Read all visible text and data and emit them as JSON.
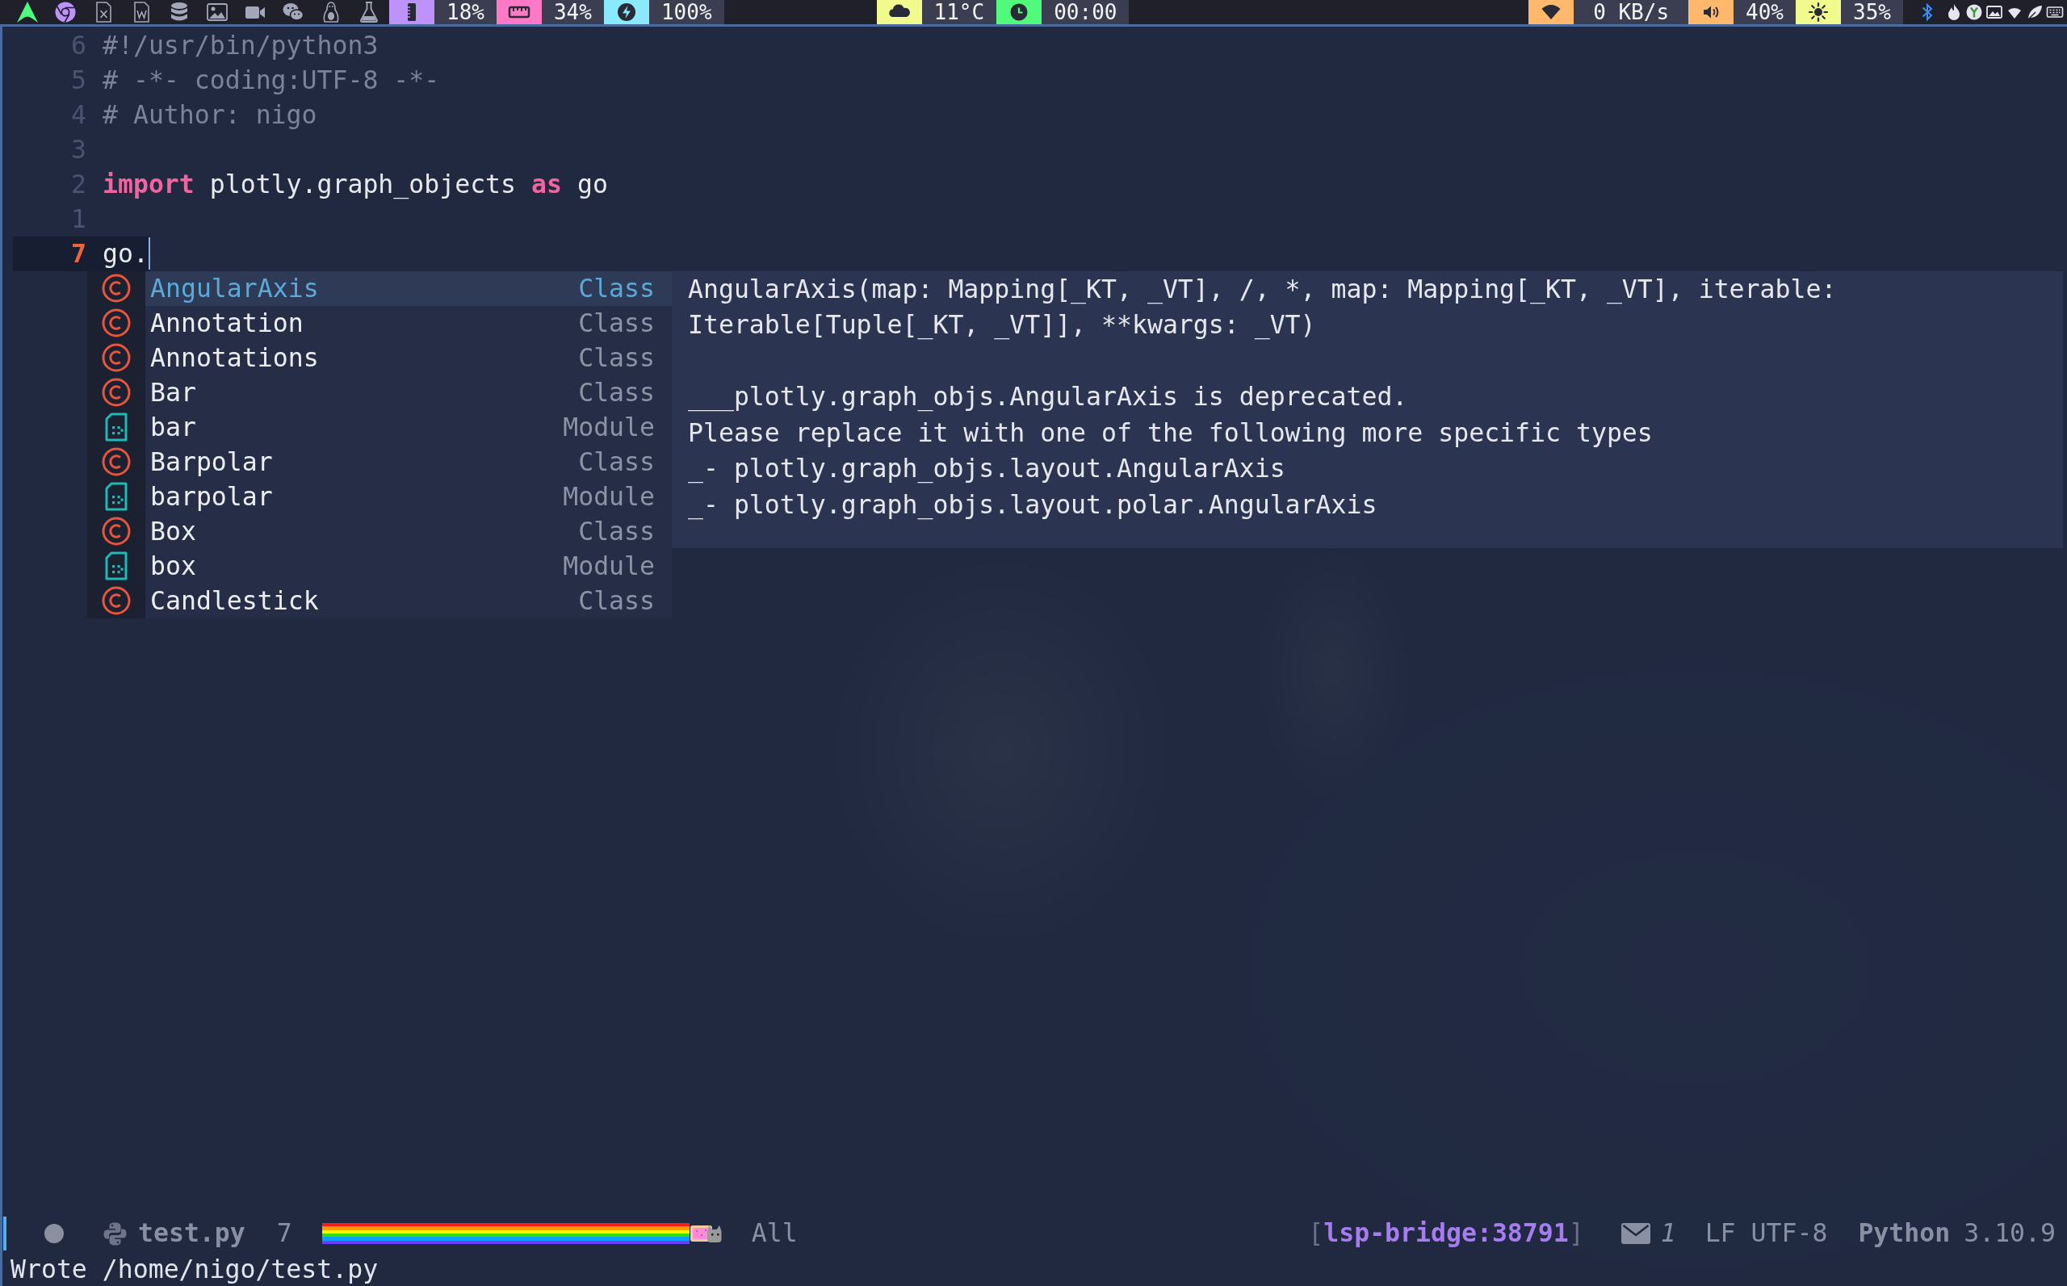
{
  "top_bar": {
    "left_segments": [
      {
        "kind": "memory",
        "color": "#bd93f9",
        "reading": "18%"
      },
      {
        "kind": "disk",
        "color": "#ff79c6",
        "reading": "34%"
      },
      {
        "kind": "battery",
        "color": "#8be9fd",
        "reading": "100%"
      }
    ],
    "center_segments": [
      {
        "kind": "weather",
        "color": "#f1fa8c",
        "reading": "11°C"
      },
      {
        "kind": "clock",
        "color": "#50fa7b",
        "reading": "00:00"
      }
    ],
    "right_segments": [
      {
        "kind": "network",
        "color": "#ffb86c",
        "reading": "0 KB/s"
      },
      {
        "kind": "volume",
        "color": "#ffb86c",
        "reading": "40%"
      },
      {
        "kind": "brightness",
        "color": "#f1fa8c",
        "reading": "35%"
      }
    ]
  },
  "editor": {
    "lines": [
      {
        "number": "6",
        "current": false,
        "tokens": [
          {
            "kind": "comment",
            "text": "#!/usr/bin/python3"
          }
        ]
      },
      {
        "number": "5",
        "current": false,
        "tokens": [
          {
            "kind": "comment",
            "text": "# -*- coding:UTF-8 -*-"
          }
        ]
      },
      {
        "number": "4",
        "current": false,
        "tokens": [
          {
            "kind": "comment",
            "text": "# Author: nigo"
          }
        ]
      },
      {
        "number": "3",
        "current": false
      },
      {
        "number": "2",
        "current": false,
        "tokens": [
          {
            "kind": "keyword",
            "text": "import"
          },
          {
            "kind": "plain",
            "text": " plotly.graph_objects "
          },
          {
            "kind": "keyword",
            "text": "as"
          },
          {
            "kind": "plain",
            "text": " go"
          }
        ]
      },
      {
        "number": "1",
        "current": false
      },
      {
        "number": "7",
        "current": true,
        "tokens": [
          {
            "kind": "plain",
            "text": "go."
          }
        ]
      }
    ]
  },
  "completion": {
    "items": [
      {
        "kind": "class",
        "label": "AngularAxis",
        "type_label": "Class",
        "selected": true
      },
      {
        "kind": "class",
        "label": "Annotation",
        "type_label": "Class",
        "selected": false
      },
      {
        "kind": "class",
        "label": "Annotations",
        "type_label": "Class",
        "selected": false
      },
      {
        "kind": "class",
        "label": "Bar",
        "type_label": "Class",
        "selected": false
      },
      {
        "kind": "module",
        "label": "bar",
        "type_label": "Module",
        "selected": false
      },
      {
        "kind": "class",
        "label": "Barpolar",
        "type_label": "Class",
        "selected": false
      },
      {
        "kind": "module",
        "label": "barpolar",
        "type_label": "Module",
        "selected": false
      },
      {
        "kind": "class",
        "label": "Box",
        "type_label": "Class",
        "selected": false
      },
      {
        "kind": "module",
        "label": "box",
        "type_label": "Module",
        "selected": false
      },
      {
        "kind": "class",
        "label": "Candlestick",
        "type_label": "Class",
        "selected": false
      }
    ]
  },
  "documentation": {
    "signature": "AngularAxis(map: Mapping[_KT, _VT], /, *, map: Mapping[_KT, _VT], iterable: Iterable[Tuple[_KT, _VT]], **kwargs: _VT)",
    "notes": [
      "___plotly.graph_objs.AngularAxis is deprecated.",
      "Please replace it with one of the following more specific types",
      "_- plotly.graph_objs.layout.AngularAxis",
      "_- plotly.graph_objs.layout.polar.AngularAxis"
    ]
  },
  "mode_line": {
    "file_name": "test.py",
    "line": "7",
    "position": "All",
    "lsp_status": "[lsp-bridge:38791]",
    "mail_count": "1",
    "line_ending": "LF",
    "encoding": "UTF-8",
    "language": "Python",
    "version": "3.10.9"
  },
  "echo_area": {
    "message": "Wrote /home/nigo/test.py"
  }
}
